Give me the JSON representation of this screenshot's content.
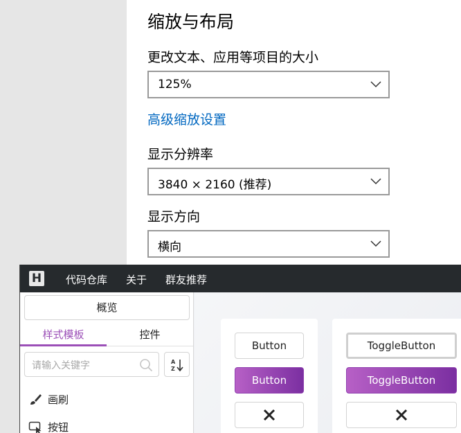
{
  "settings": {
    "title": "缩放与布局",
    "scale_label": "更改文本、应用等项目的大小",
    "scale_value": "125%",
    "advanced_link": "高级缩放设置",
    "resolution_label": "显示分辨率",
    "resolution_value": "3840 × 2160 (推荐)",
    "orientation_label": "显示方向",
    "orientation_value": "横向"
  },
  "app": {
    "logo": "H",
    "menu": [
      "代码仓库",
      "关于",
      "群友推荐"
    ],
    "sidebar": {
      "overview": "概览",
      "tabs": [
        "样式模板",
        "控件"
      ],
      "search_placeholder": "请输入关键字",
      "items": [
        {
          "label": "画刷",
          "icon": "brush-icon"
        },
        {
          "label": "按钮",
          "icon": "button-icon"
        }
      ]
    },
    "cards": {
      "button": {
        "plain": "Button",
        "primary": "Button",
        "icon": "close-icon"
      },
      "toggle": {
        "checked": "ToggleButton",
        "primary": "ToggleButton",
        "icon": "close-icon"
      }
    },
    "colors": {
      "accent": "#9b4fb7",
      "titlebar": "#262a2d",
      "link": "#0067c0"
    }
  }
}
